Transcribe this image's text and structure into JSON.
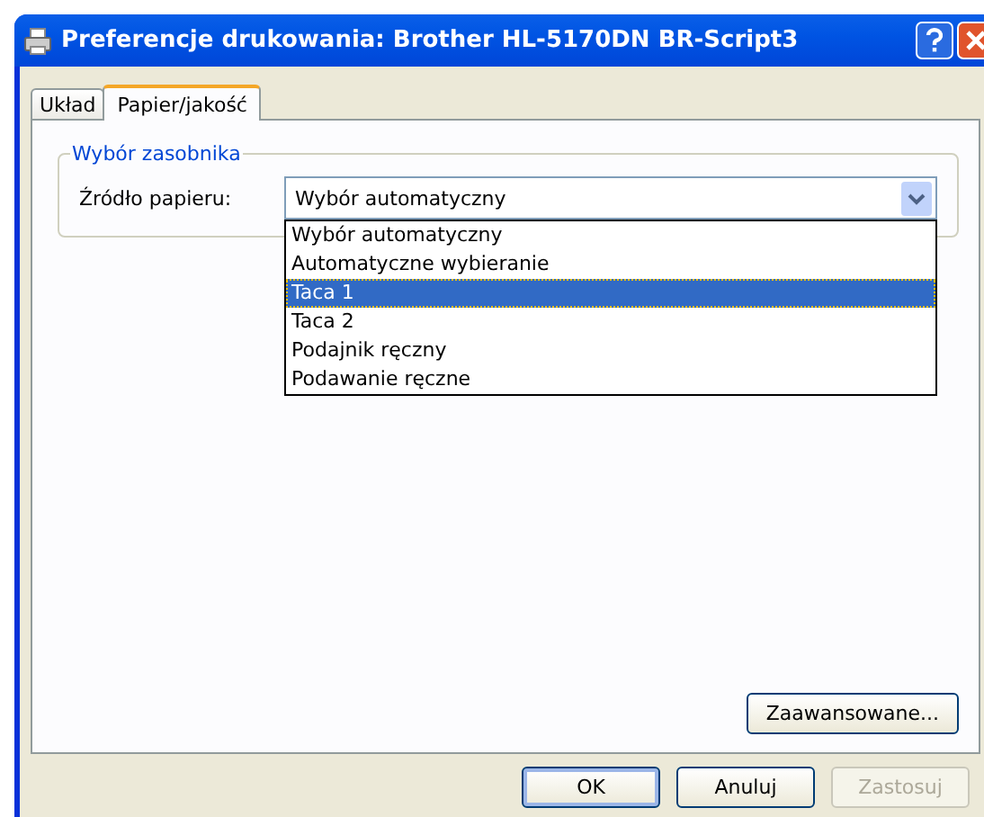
{
  "window": {
    "title": "Preferencje drukowania: Brother HL-5170DN BR-Script3"
  },
  "tabs": [
    {
      "label": "Układ",
      "selected": false
    },
    {
      "label": "Papier/jakość",
      "selected": true
    }
  ],
  "group": {
    "title": "Wybór zasobnika",
    "label": "Źródło papieru:",
    "value": "Wybór automatyczny"
  },
  "dropdown_options": [
    {
      "label": "Wybór automatyczny",
      "selected": false
    },
    {
      "label": "Automatyczne wybieranie",
      "selected": false
    },
    {
      "label": "Taca 1",
      "selected": true
    },
    {
      "label": "Taca 2",
      "selected": false
    },
    {
      "label": "Podajnik ręczny",
      "selected": false
    },
    {
      "label": "Podawanie ręczne",
      "selected": false
    }
  ],
  "advanced_button": "Zaawansowane...",
  "buttons": [
    {
      "label": "OK",
      "disabled": false,
      "default": true
    },
    {
      "label": "Anuluj",
      "disabled": false,
      "default": false
    },
    {
      "label": "Zastosuj",
      "disabled": true,
      "default": false
    }
  ]
}
